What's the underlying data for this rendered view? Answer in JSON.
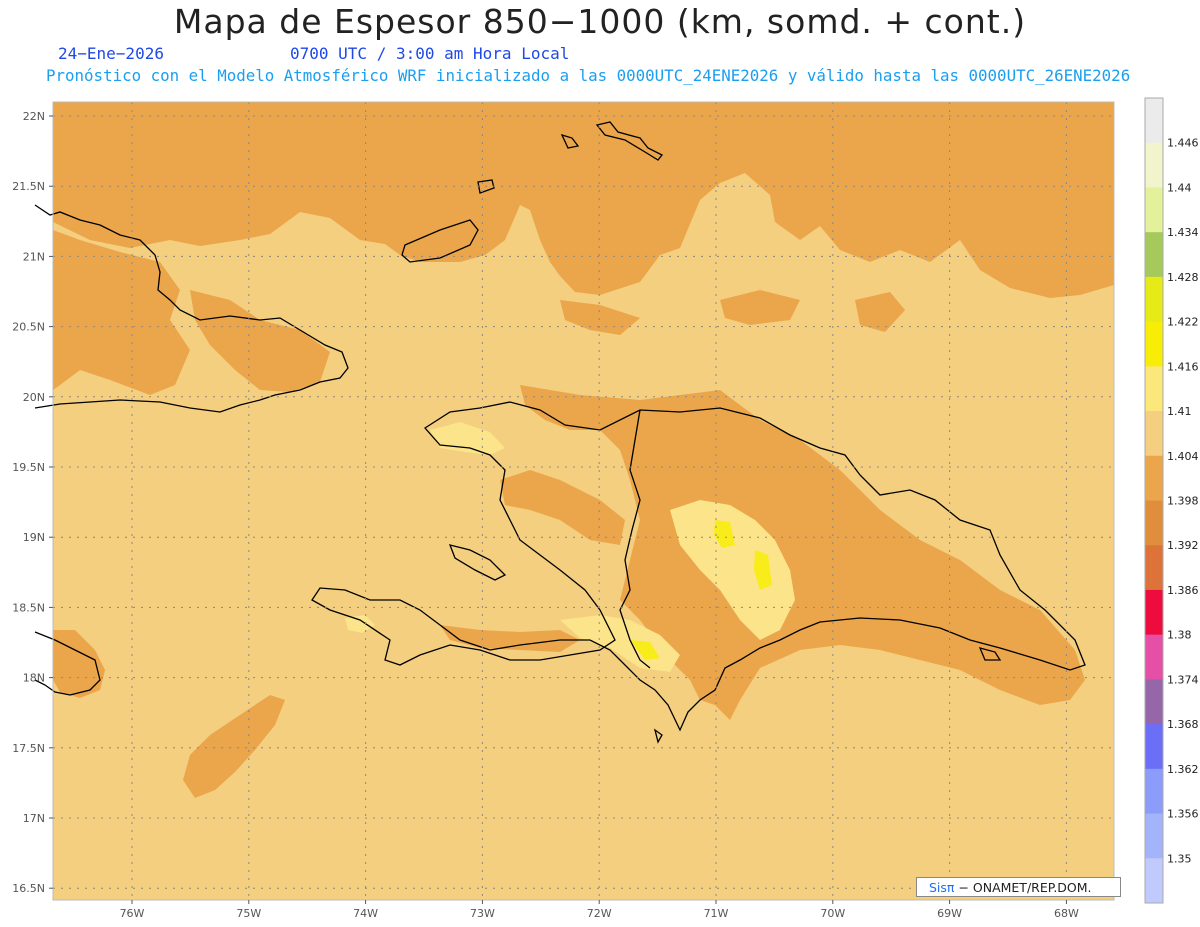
{
  "header": {
    "title": "Mapa de Espesor 850−1000 (km, somd. + cont.)",
    "date": "24−Ene−2026",
    "time": "0700 UTC / 3:00 am Hora Local",
    "forecast": "Pronóstico con el Modelo Atmosférico WRF inicializado a las 0000UTC_24ENE2026 y válido hasta las  0000UTC_26ENE2026"
  },
  "map": {
    "lat_labels": [
      "22N",
      "21.5N",
      "21N",
      "20.5N",
      "20N",
      "19.5N",
      "19N",
      "18.5N",
      "18N",
      "17.5N",
      "17N",
      "16.5N"
    ],
    "lon_labels": [
      "76W",
      "75W",
      "74W",
      "73W",
      "72W",
      "71W",
      "70W",
      "69W",
      "68W"
    ],
    "lat_range": [
      16.4,
      22.1
    ],
    "lon_range": [
      -76.7,
      -67.6
    ],
    "colors": {
      "sea": "#f3cf7f",
      "land_low": "#eba54a",
      "land_lower": "#e08e3c",
      "warm_1": "#fbe48a",
      "warm_2": "#f8ed1a",
      "coast": "#000000",
      "grid": "#888888"
    }
  },
  "colorbar": {
    "labels": [
      "1.446",
      "1.44",
      "1.434",
      "1.428",
      "1.422",
      "1.416",
      "1.41",
      "1.404",
      "1.398",
      "1.392",
      "1.386",
      "1.38",
      "1.374",
      "1.368",
      "1.362",
      "1.356",
      "1.35"
    ],
    "colors": [
      "#ebebeb",
      "#f2f4cc",
      "#e3f19a",
      "#a6c95c",
      "#e6ea16",
      "#f8ed06",
      "#fbe77a",
      "#f3cf7f",
      "#eba54a",
      "#e08e3c",
      "#de733a",
      "#ee0b3d",
      "#e550a6",
      "#9567a8",
      "#6b6ef6",
      "#8b9cfb",
      "#a4b4fb",
      "#c1cafc"
    ]
  },
  "credit": {
    "brand": "Sisπ",
    "text": "− ONAMET/REP.DOM."
  }
}
